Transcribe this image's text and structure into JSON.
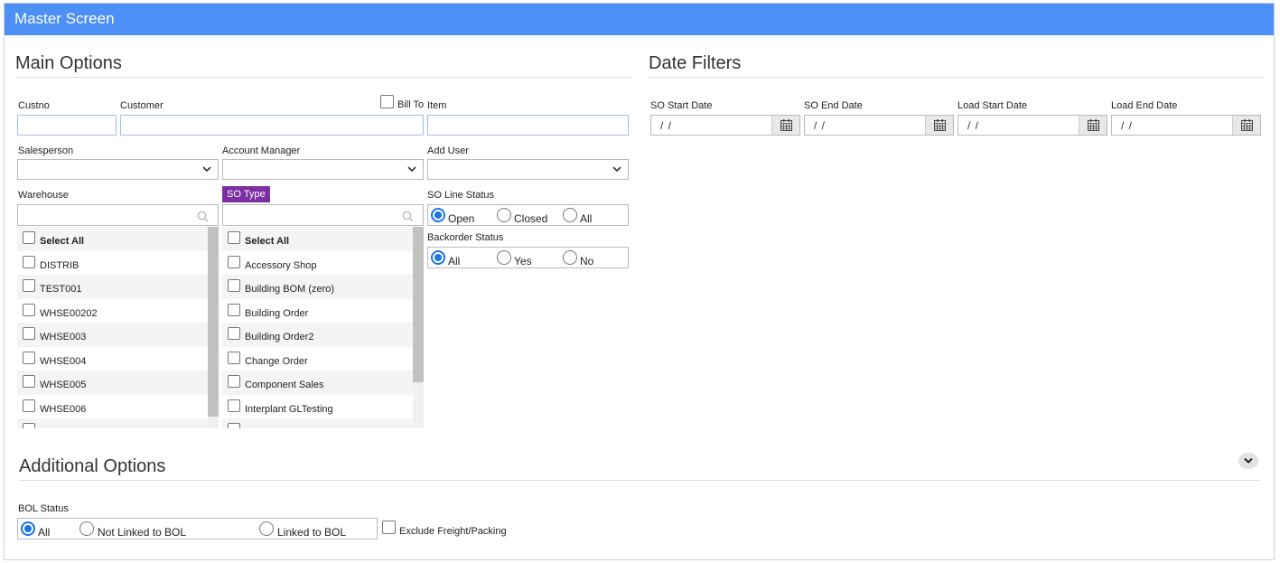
{
  "window": {
    "title": "Master Screen"
  },
  "main_options": {
    "title": "Main Options",
    "custno": {
      "label": "Custno",
      "value": ""
    },
    "customer": {
      "label": "Customer",
      "value": ""
    },
    "bill_to": {
      "label": "Bill To",
      "checked": false
    },
    "item": {
      "label": "Item",
      "value": ""
    },
    "salesperson": {
      "label": "Salesperson",
      "value": ""
    },
    "account_manager": {
      "label": "Account Manager",
      "value": ""
    },
    "add_user": {
      "label": "Add User",
      "value": ""
    },
    "warehouse": {
      "label": "Warehouse",
      "search_value": "",
      "items": [
        "Select All",
        "DISTRIB",
        "TEST001",
        "WHSE00202",
        "WHSE003",
        "WHSE004",
        "WHSE005",
        "WHSE006"
      ]
    },
    "so_type": {
      "label": "SO Type",
      "search_value": "",
      "items": [
        "Select All",
        "Accessory Shop",
        "Building BOM (zero)",
        "Building Order",
        "Building Order2",
        "Change Order",
        "Component Sales",
        "Interplant GLTesting"
      ]
    },
    "so_line_status": {
      "label": "SO Line Status",
      "options": [
        "Open",
        "Closed",
        "All"
      ],
      "selected": "Open"
    },
    "backorder_status": {
      "label": "Backorder Status",
      "options": [
        "All",
        "Yes",
        "No"
      ],
      "selected": "All"
    }
  },
  "date_filters": {
    "title": "Date Filters",
    "fields": [
      {
        "label": "SO Start Date",
        "value": "/ /"
      },
      {
        "label": "SO End Date",
        "value": "/ /"
      },
      {
        "label": "Load Start Date",
        "value": "/ /"
      },
      {
        "label": "Load End Date",
        "value": "/ /"
      }
    ]
  },
  "additional_options": {
    "title": "Additional Options",
    "bol_status": {
      "label": "BOL Status",
      "options": [
        "All",
        "Not Linked to BOL",
        "Linked to BOL"
      ],
      "selected": "All"
    },
    "exclude_freight": {
      "label": "Exclude Freight/Packing",
      "checked": false
    }
  },
  "colors": {
    "header": "#4c8ff5",
    "so_type_tag": "#7b2fa2",
    "radio_selected": "#1a73e8",
    "input_border_focus": "#9dbff0"
  },
  "icons": [
    "calendar-icon",
    "chevron-down-icon",
    "search-icon"
  ]
}
